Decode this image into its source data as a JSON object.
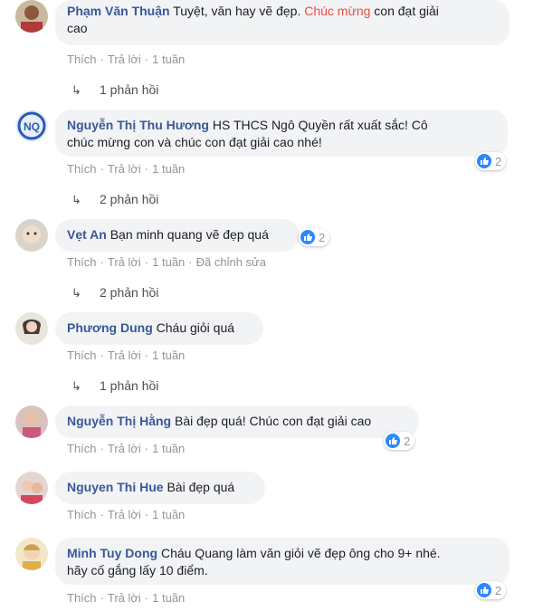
{
  "actions": {
    "like": "Thích",
    "reply": "Trả lời",
    "edited": "Đã chỉnh sửa",
    "dot": "·"
  },
  "comments": [
    {
      "name": "Phạm Văn Thuận",
      "text_a": " Tuyệt, văn hay vẽ đẹp. ",
      "highlight": "Chúc mừng",
      "text_b": " con đạt giải",
      "text_c": "cao",
      "time": "1 tuần",
      "replies": "1 phản hồi"
    },
    {
      "name": "Nguyễn Thị Thu Hương",
      "text_a": " HS THCS Ngô Quyền rất xuất sắc! Cô",
      "text_c": "chúc mừng con và chúc con đạt giải cao nhé!",
      "time": "1 tuần",
      "replies": "2 phản hồi",
      "likes": "2"
    },
    {
      "name": "Vẹt An",
      "text_a": " Bạn minh quang vẽ đẹp quá",
      "time": "1 tuần",
      "replies": "2 phản hồi",
      "likes": "2"
    },
    {
      "name": "Phương Dung",
      "text_a": " Cháu giỏi quá",
      "time": "1 tuần",
      "replies": "1 phản hồi"
    },
    {
      "name": "Nguyễn Thị Hằng",
      "text_a": " Bài đẹp quá! Chúc con đạt giải cao",
      "time": "1 tuần",
      "likes": "2"
    },
    {
      "name": "Nguyen Thi Hue",
      "text_a": " Bài đẹp quá",
      "time": "1 tuần"
    },
    {
      "name": "Minh Tuy Dong",
      "text_a": " Cháu Quang làm văn giỏi vẽ đẹp ông cho 9+ nhé.",
      "text_c": "hãy cố gắng lấy 10 điểm.",
      "time": "1 tuần",
      "likes": "2"
    }
  ],
  "colors": {
    "name": "#385898",
    "highlight": "#e9503f",
    "bubble": "#f2f3f5",
    "meta": "#90949c",
    "like": "#2d88ff"
  }
}
